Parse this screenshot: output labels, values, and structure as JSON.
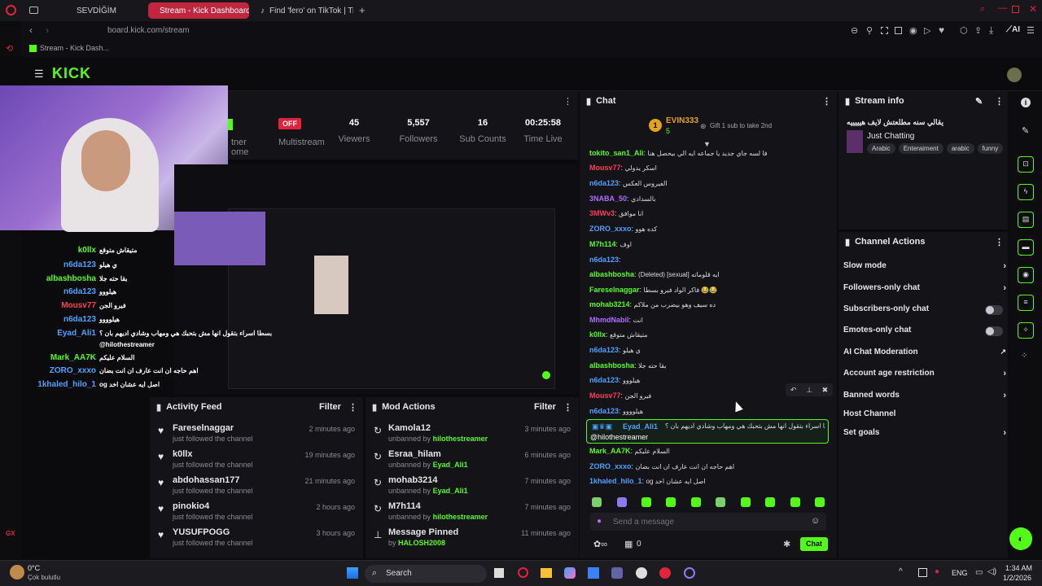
{
  "browser": {
    "tabs": [
      "SEVDİĞİM",
      "Stream - Kick Dashboard",
      "Find 'fero' on TikTok | TikT"
    ],
    "url": "board.kick.com/stream",
    "bookmark": "Stream - Kick Dash..."
  },
  "stats": {
    "partner_label": "tner",
    "partner_sub": "ome",
    "multistream_badge": "OFF",
    "multistream_label": "Multistream",
    "viewers": "45",
    "viewers_label": "Viewers",
    "followers": "5,557",
    "followers_label": "Followers",
    "subs": "16",
    "subs_label": "Sub Counts",
    "time": "00:25:58",
    "time_label": "Time Live"
  },
  "overlay_chat": [
    {
      "user": "k0llx",
      "msg": "متيقاش متوقع",
      "color": "#53fc18"
    },
    {
      "user": "n6da123",
      "msg": "ي هيلو",
      "color": "#4aa3ff"
    },
    {
      "user": "albashbosha",
      "msg": "بقا حته جلا",
      "color": "#53fc18"
    },
    {
      "user": "n6da123",
      "msg": "هيلووو",
      "color": "#4aa3ff"
    },
    {
      "user": "Mousv77",
      "msg": "فيرو الجن",
      "color": "#ff3b5c"
    },
    {
      "user": "n6da123",
      "msg": "هيلوووو",
      "color": "#4aa3ff"
    },
    {
      "user": "Eyad_Ali1",
      "msg": "بسطا اسراء بتقول انها مش بتحبك هي ومهاب وشادي اديهم بان ؟",
      "color": "#4aa3ff"
    },
    {
      "user": "",
      "msg": "@hilothestreamer",
      "color": "#ffffff"
    },
    {
      "user": "Mark_AA7K",
      "msg": "السلام عليكم",
      "color": "#53fc18"
    },
    {
      "user": "ZORO_xxxo",
      "msg": "اهم حاجه ان انت عارف ان انت بضان",
      "color": "#4aa3ff"
    },
    {
      "user": "1khaled_hilo_1",
      "msg": "og اصل ايه عشان اخد",
      "color": "#4aa3ff"
    }
  ],
  "activity": {
    "title": "Activity Feed",
    "filter": "Filter",
    "items": [
      {
        "name": "Fareselnaggar",
        "sub": "just followed the channel",
        "ago": "2 minutes ago"
      },
      {
        "name": "k0llx",
        "sub": "just followed the channel",
        "ago": "19 minutes ago"
      },
      {
        "name": "abdohassan177",
        "sub": "just followed the channel",
        "ago": "21 minutes ago"
      },
      {
        "name": "pinokio4",
        "sub": "just followed the channel",
        "ago": "2 hours ago"
      },
      {
        "name": "YUSUFPOGG",
        "sub": "just followed the channel",
        "ago": "3 hours ago"
      }
    ]
  },
  "mod": {
    "title": "Mod Actions",
    "filter": "Filter",
    "items": [
      {
        "name": "Kamola12",
        "pre": "unbanned by",
        "by": "hilothestreamer",
        "ago": "3 minutes ago"
      },
      {
        "name": "Esraa_hilam",
        "pre": "unbanned by",
        "by": "Eyad_Ali1",
        "ago": "6 minutes ago"
      },
      {
        "name": "mohab3214",
        "pre": "unbanned by",
        "by": "Eyad_Ali1",
        "ago": "7 minutes ago"
      },
      {
        "name": "M7h114",
        "pre": "unbanned by",
        "by": "hilothestreamer",
        "ago": "7 minutes ago"
      },
      {
        "name": "Message Pinned",
        "pre": "by",
        "by": "HALOSH2008",
        "ago": "11 minutes ago"
      }
    ]
  },
  "chat": {
    "title": "Chat",
    "top_user": "EVIN333",
    "top_count": "5",
    "gift_text": "Gift 1 sub to take 2nd",
    "placeholder": "Send a message",
    "send": "Chat",
    "count": "0",
    "lines": [
      {
        "user": "tokito_san1_Ali",
        "msg": "فا لسه جاي جديد يا جماعه ايه الي بيحصل هنا",
        "color": "#53fc18"
      },
      {
        "user": "Mousv77",
        "msg": "اسكر يدولي",
        "color": "#ff3b5c"
      },
      {
        "user": "n6da123",
        "msg": "الفيروس العكس",
        "color": "#4aa3ff"
      },
      {
        "user": "3NABA_50",
        "msg": "بالسدادي",
        "color": "#b06bff"
      },
      {
        "user": "3MWv3",
        "msg": "انا موافق",
        "color": "#ff3b5c"
      },
      {
        "user": "ZORO_xxxo",
        "msg": "كده هوو",
        "color": "#4aa3ff"
      },
      {
        "user": "M7h114",
        "msg": "اوف",
        "color": "#53fc18"
      },
      {
        "user": "n6da123",
        "msg": "",
        "color": "#4aa3ff"
      },
      {
        "user": "albashbosha",
        "msg": "(Deleted) [sexual] ايه قلوماته",
        "color": "#53fc18"
      },
      {
        "user": "Fareselnaggar",
        "msg": "فاكر الواد فيرو بسطا 😂😂",
        "color": "#53fc18"
      },
      {
        "user": "mohab3214",
        "msg": "ده سيف وهو بيضرب من ملاكم",
        "color": "#53fc18"
      },
      {
        "user": "MhmdNabil",
        "msg": "انت",
        "color": "#b06bff"
      },
      {
        "user": "k0llx",
        "msg": "متيقاش متوقع",
        "color": "#53fc18"
      },
      {
        "user": "n6da123",
        "msg": "ي هيلو",
        "color": "#4aa3ff"
      },
      {
        "user": "albashbosha",
        "msg": "بقا حته جلا",
        "color": "#53fc18"
      },
      {
        "user": "n6da123",
        "msg": "هيلووو",
        "color": "#4aa3ff"
      },
      {
        "user": "Mousv77",
        "msg": "فيرو الجن",
        "color": "#ff3b5c"
      },
      {
        "user": "n6da123",
        "msg": "هيلوووو",
        "color": "#4aa3ff"
      }
    ],
    "highlight_user": "Eyad_Ali1",
    "highlight_msg": "بسطا اسراء بتقول انها مش بتحبك هي ومهاب وشادي اديهم بان ؟",
    "highlight_mention": "@hilothestreamer",
    "tail": [
      {
        "user": "Mark_AA7K",
        "msg": "السلام عليكم",
        "color": "#53fc18"
      },
      {
        "user": "ZORO_xxxo",
        "msg": "اهم حاجه ان انت عارف ان انت بضان",
        "color": "#4aa3ff"
      },
      {
        "user": "1khaled_hilo_1",
        "msg": "og اصل ايه عشان اخد",
        "color": "#4aa3ff"
      }
    ]
  },
  "stream_info": {
    "title": "Stream info",
    "stream_title": "يقالي سنه مطلعتش لايف هيييييه",
    "category": "Just Chatting",
    "tags": [
      "Arabic",
      "Enteraiment",
      "arabic",
      "funny"
    ]
  },
  "channel_actions": {
    "title": "Channel Actions",
    "items": [
      {
        "label": "Slow mode",
        "kind": "chev"
      },
      {
        "label": "Followers-only chat",
        "kind": "chev"
      },
      {
        "label": "Subscribers-only chat",
        "kind": "toggle"
      },
      {
        "label": "Emotes-only chat",
        "kind": "toggle"
      },
      {
        "label": "AI Chat Moderation",
        "kind": "ext"
      },
      {
        "label": "Account age restriction",
        "kind": "chev"
      },
      {
        "label": "Banned words",
        "kind": "chev"
      },
      {
        "label": "Host Channel",
        "kind": "none"
      },
      {
        "label": "Set goals",
        "kind": "chev"
      }
    ]
  },
  "taskbar": {
    "weather": "0°C",
    "weather_sub": "Çok bulutlu",
    "search": "Search",
    "lang": "ENG",
    "time": "1:34 AM",
    "date": "1/2/2026"
  }
}
